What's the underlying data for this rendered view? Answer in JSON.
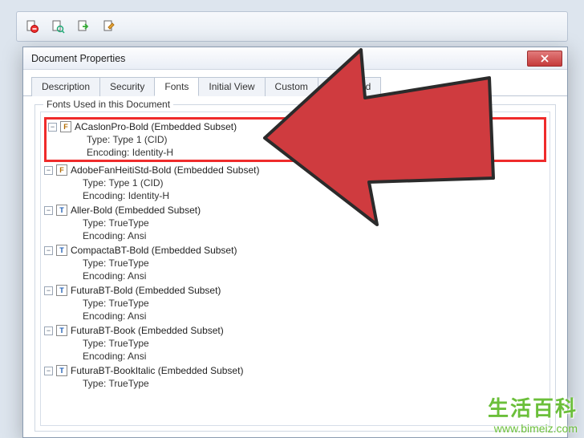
{
  "toolbar": {
    "icons": [
      "doc-remove",
      "doc-search",
      "doc-export",
      "doc-edit"
    ]
  },
  "dialog": {
    "title": "Document Properties",
    "tabs": [
      {
        "label": "Description"
      },
      {
        "label": "Security"
      },
      {
        "label": "Fonts"
      },
      {
        "label": "Initial View"
      },
      {
        "label": "Custom"
      },
      {
        "label": "Advanced"
      }
    ],
    "active_tab": 2,
    "group_legend": "Fonts Used in this Document"
  },
  "fonts": [
    {
      "name": "ACaslonPro-Bold (Embedded Subset)",
      "type_line": "Type: Type 1 (CID)",
      "encoding_line": "Encoding: Identity-H",
      "icon": "type1",
      "highlighted": true
    },
    {
      "name": "AdobeFanHeitiStd-Bold (Embedded Subset)",
      "type_line": "Type: Type 1 (CID)",
      "encoding_line": "Encoding: Identity-H",
      "icon": "type1",
      "highlighted": false
    },
    {
      "name": "Aller-Bold (Embedded Subset)",
      "type_line": "Type: TrueType",
      "encoding_line": "Encoding: Ansi",
      "icon": "tt",
      "highlighted": false
    },
    {
      "name": "CompactaBT-Bold (Embedded Subset)",
      "type_line": "Type: TrueType",
      "encoding_line": "Encoding: Ansi",
      "icon": "tt",
      "highlighted": false
    },
    {
      "name": "FuturaBT-Bold (Embedded Subset)",
      "type_line": "Type: TrueType",
      "encoding_line": "Encoding: Ansi",
      "icon": "tt",
      "highlighted": false
    },
    {
      "name": "FuturaBT-Book (Embedded Subset)",
      "type_line": "Type: TrueType",
      "encoding_line": "Encoding: Ansi",
      "icon": "tt",
      "highlighted": false
    },
    {
      "name": "FuturaBT-BookItalic (Embedded Subset)",
      "type_line": "Type: TrueType",
      "encoding_line": "",
      "icon": "tt",
      "highlighted": false
    }
  ],
  "watermark": {
    "text": "生活百科",
    "url": "www.bimeiz.com"
  }
}
